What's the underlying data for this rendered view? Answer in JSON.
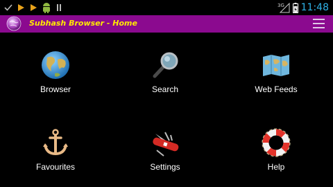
{
  "status_bar": {
    "notifications": [
      "check-icon",
      "play-store-icon",
      "play-music-icon",
      "android-icon",
      "pause-icon"
    ],
    "network_label": "3G",
    "time": "11:48"
  },
  "app_bar": {
    "title": "Subhash Browser - Home",
    "app_icon": "globe-logo-icon",
    "menu_icon": "hamburger-menu-icon"
  },
  "tiles": [
    {
      "label": "Browser",
      "icon": "globe-icon"
    },
    {
      "label": "Search",
      "icon": "magnifier-icon"
    },
    {
      "label": "Web Feeds",
      "icon": "map-icon"
    },
    {
      "label": "Favourites",
      "icon": "anchor-icon"
    },
    {
      "label": "Settings",
      "icon": "swiss-knife-icon"
    },
    {
      "label": "Help",
      "icon": "lifebuoy-icon"
    }
  ],
  "colors": {
    "app_bar_bg": "#8b0a8f",
    "title": "#ffea00",
    "clock": "#2fb3e8",
    "background": "#000000"
  }
}
